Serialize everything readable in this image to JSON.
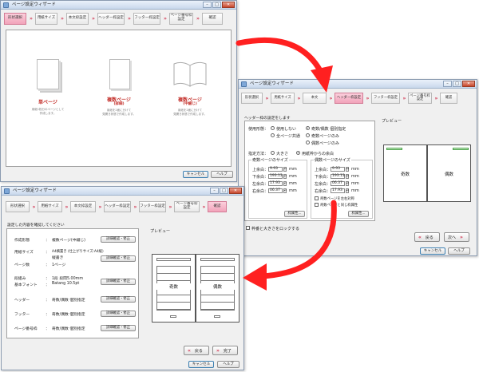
{
  "window_title": "ページ設定ウィザード",
  "colors": {
    "accent_red": "#d23a55",
    "active_step": "#f2a3ba",
    "arrow": "#ff2020"
  },
  "steps": {
    "s1": "形状選択",
    "s2": "用紙サイズ",
    "s3": "本文枠設定",
    "s4": "ヘッダー枠設定",
    "s5": "フッター枠設定",
    "s6_line1": "ページ番号枠",
    "s6_line2": "設定",
    "s7": "確認",
    "s3_truncated": "本文"
  },
  "win1": {
    "cards": [
      {
        "label": "単ページ",
        "sub1": "用紙1枚分のページとして",
        "sub2": "作成します。"
      },
      {
        "label": "複数ページ",
        "sublabel": "(詳細)",
        "sub1": "用紙を2面に分けて",
        "sub2": "見開き状態で作成します。"
      },
      {
        "label": "複数ページ",
        "sublabel": "(中綴じ)",
        "sub1": "用紙を2面に分けて",
        "sub2": "見開き状態で作成します。"
      }
    ],
    "ok": "キャンセル",
    "help": "ヘルプ"
  },
  "win2": {
    "header_note": "ヘッダー枠の設定をします",
    "setting_method": "使用形態：",
    "opt_none": "使用しない",
    "opt_odd_even": "奇数/偶数 個別指定",
    "opt_all_same": "全ページ共通",
    "opt_odd_only": "奇数ページのみ",
    "opt_even_only": "偶数ページのみ",
    "spec_method": "指定方法：",
    "opt_size": "大きさ",
    "opt_margin": "用紙枠からの余白",
    "odd_size": "奇数ページのサイズ",
    "even_size": "偶数ページのサイズ",
    "margins": [
      {
        "label": "上余白：",
        "odd": "9.93",
        "even": "9.93"
      },
      {
        "label": "下余白：",
        "odd": "193.13",
        "even": "193.13"
      },
      {
        "label": "左余白：",
        "odd": "17.93",
        "even": "06.37"
      },
      {
        "label": "右余白：",
        "odd": "06.37",
        "even": "17.93"
      }
    ],
    "unit": "mm",
    "chk_same_odd": "奇数ページを左右対称",
    "chk_same_even": "奇数ページと同じ枠属性",
    "attr_btn": "枠属性...",
    "chk_bottom": "枠番と大きさをロックする",
    "preview": "プレビュー",
    "odd_page": "奇数",
    "even_page": "偶数",
    "back": "戻る",
    "next": "次へ",
    "cancel": "キャンセル",
    "help": "ヘルプ"
  },
  "win3": {
    "note": "設定した内容を確認してください",
    "rows": [
      {
        "label": "作成形態",
        "value": "複数ページ(中綴じ)",
        "btn": "詳細確認・修正"
      },
      {
        "label": "用紙サイズ",
        "value": "A4横置き (仕上がりサイズ:A4縦)",
        "value2": "縦書き",
        "btn": "詳細確認・修正"
      },
      {
        "label": "ページ数",
        "value": "1ページ"
      },
      {
        "label": "段組み",
        "value": "1段 段間5.00mm",
        "btn": "詳細確認・修正"
      },
      {
        "label": "基本フォント",
        "value": "Batang 10.5pt"
      },
      {
        "label": "ヘッダー",
        "value": "奇数/偶数 個別指定",
        "btn": "詳細確認・修正"
      },
      {
        "label": "フッター",
        "value": "奇数/偶数 個別指定",
        "btn": "詳細確認・修正"
      },
      {
        "label": "ページ番号枠",
        "value": "奇数/偶数 個別指定",
        "btn": "詳細確認・修正"
      }
    ],
    "preview": "プレビュー",
    "odd_page": "奇数",
    "even_page": "偶数",
    "back": "戻る",
    "finish": "完了",
    "cancel": "キャンセル",
    "help": "ヘルプ"
  }
}
